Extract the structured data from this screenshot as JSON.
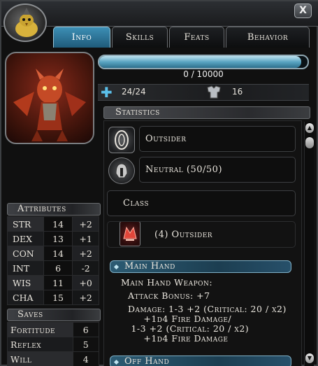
{
  "window": {
    "close_label": "X"
  },
  "tabs": [
    {
      "label": "Info",
      "active": true
    },
    {
      "label": "Skills",
      "active": false
    },
    {
      "label": "Feats",
      "active": false
    },
    {
      "label": "Behavior",
      "active": false
    }
  ],
  "experience": {
    "current": 0,
    "max": 10000,
    "text": "0 / 10000",
    "fraction": 0.97
  },
  "vitals": {
    "hp_text": "24/24",
    "ac_text": "16"
  },
  "statistics": {
    "header": "Statistics",
    "race": "Outsider",
    "alignment": "Neutral (50/50)",
    "class_label": "Class",
    "class_entry": "(4) Outsider"
  },
  "main_hand": {
    "header": "Main Hand",
    "title": "Main Hand Weapon:",
    "attack_bonus": "Attack Bonus: +7",
    "damage_lines": [
      "Damage: 1-3 +2 (Critical: 20 / x2)",
      "     +1d4 Fire Damage/",
      " 1-3 +2 (Critical: 20 / x2)",
      "     +1d4 Fire Damage"
    ]
  },
  "off_hand": {
    "header": "Off Hand"
  },
  "attributes": {
    "header": "Attributes",
    "rows": [
      {
        "name": "STR",
        "value": "14",
        "mod": "+2"
      },
      {
        "name": "DEX",
        "value": "13",
        "mod": "+1"
      },
      {
        "name": "CON",
        "value": "14",
        "mod": "+2"
      },
      {
        "name": "INT",
        "value": "6",
        "mod": "-2"
      },
      {
        "name": "WIS",
        "value": "11",
        "mod": "+0"
      },
      {
        "name": "CHA",
        "value": "15",
        "mod": "+2"
      }
    ]
  },
  "saves": {
    "header": "Saves",
    "rows": [
      {
        "name": "Fortitude",
        "value": "6"
      },
      {
        "name": "Reflex",
        "value": "5"
      },
      {
        "name": "Will",
        "value": "4"
      }
    ]
  },
  "icons": {
    "small_portrait": "creature-portrait-icon",
    "hp": "plus-icon",
    "ac": "armor-icon",
    "race": "race-emblem-icon",
    "alignment": "alignment-helm-icon",
    "class": "class-emblem-icon"
  },
  "colors": {
    "accent": "#3d8fb5",
    "xp_fill": "#5aa5c2",
    "hp_icon": "#5bc0ea"
  }
}
